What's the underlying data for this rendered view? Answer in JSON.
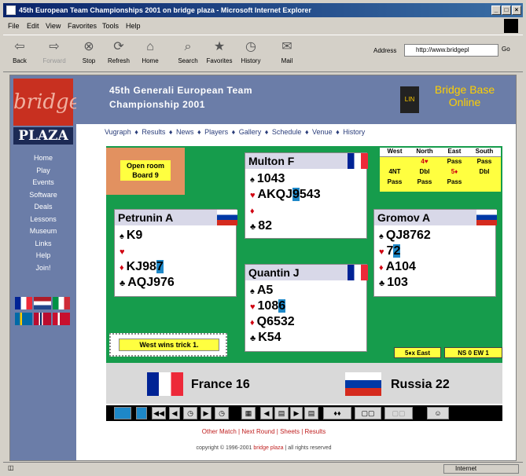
{
  "window": {
    "title": "45th European Team Championships 2001 on bridge plaza - Microsoft Internet Explorer"
  },
  "menu": [
    "File",
    "Edit",
    "View",
    "Favorites",
    "Tools",
    "Help"
  ],
  "toolbar": [
    "Back",
    "Forward",
    "Stop",
    "Refresh",
    "Home",
    "Search",
    "Favorites",
    "History",
    "Mail"
  ],
  "address": {
    "label": "Address",
    "value": "http://www.bridgepl",
    "go": "Go"
  },
  "sidebar": {
    "logo_top": "bridge",
    "logo_bottom": "PLAZA",
    "items": [
      "Home",
      "Play",
      "Events",
      "Software",
      "Deals",
      "Lessons",
      "Museum",
      "Links",
      "Help",
      "Join!"
    ]
  },
  "header": {
    "title_line1": "45th Generali European Team",
    "title_line2": "Championship 2001",
    "bbo_icon": "LIN",
    "bbo_line1": "Bridge Base",
    "bbo_line2": "Online"
  },
  "topnav": [
    "Vugraph",
    "Results",
    "News",
    "Players",
    "Gallery",
    "Schedule",
    "Venue",
    "History"
  ],
  "topnav_sep": "♦",
  "room": {
    "line1": "Open room",
    "line2": "Board 9"
  },
  "bidding": {
    "headers": [
      "West",
      "North",
      "East",
      "South"
    ],
    "row1": [
      "",
      "4♥",
      "Pass",
      "Pass"
    ],
    "row2": [
      "4NT",
      "Dbl",
      "5♦",
      "Dbl"
    ],
    "row3": [
      "Pass",
      "Pass",
      "Pass",
      ""
    ]
  },
  "hands": {
    "north": {
      "name": "Multon F",
      "spades": "1043",
      "hearts_pre": "AKQJ",
      "hearts_hl": "9",
      "hearts_post": "543",
      "diamonds": "",
      "clubs": "82"
    },
    "west": {
      "name": "Petrunin A",
      "spades": "K9",
      "hearts": "",
      "diamonds_pre": "KJ98",
      "diamonds_hl": "7",
      "clubs": "AQJ976"
    },
    "east": {
      "name": "Gromov A",
      "spades": "QJ8762",
      "hearts_pre": "7",
      "hearts_hl": "2",
      "diamonds": "A104",
      "clubs": "103"
    },
    "south": {
      "name": "Quantin J",
      "spades": "A5",
      "hearts_pre": "108",
      "hearts_hl": "6",
      "diamonds": "Q6532",
      "clubs": "K54"
    }
  },
  "trick_message": "West wins trick 1.",
  "contract": "5♦x East",
  "score": "NS 0  EW 1",
  "teams": {
    "left": "France 16",
    "right": "Russia 22"
  },
  "footer": {
    "links": "Other Match | Next Round | Sheets | Results",
    "copyright": "copyright © 1996-2001",
    "brand": "bridge plaza",
    "rights": "| all rights reserved"
  },
  "status": {
    "zone": "Internet"
  },
  "colors": {
    "felt": "#169c4c",
    "sidebar": "#6b7da8",
    "highlight": "#1e88c8"
  }
}
